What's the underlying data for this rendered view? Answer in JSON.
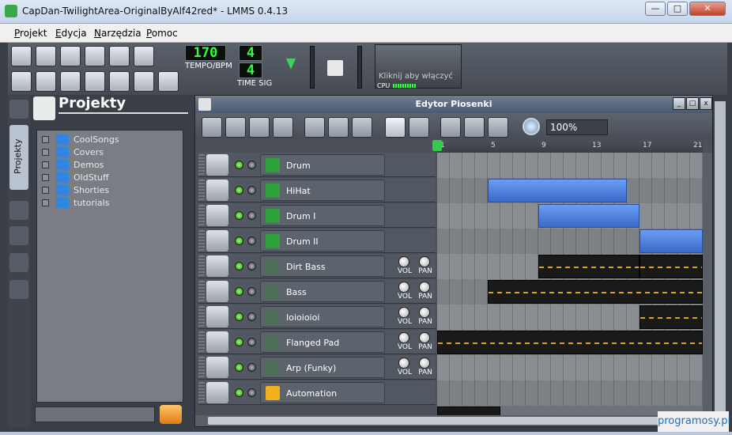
{
  "window": {
    "title": "CapDan-TwilightArea-OriginalByAlf42red* - LMMS 0.4.13",
    "controls": {
      "minimize": "—",
      "maximize": "□",
      "close": "✕"
    }
  },
  "menu": [
    "Projekt",
    "Edycja",
    "Narzędzia",
    "Pomoc"
  ],
  "toolbar": {
    "tempo_value": "170",
    "tempo_label": "TEMPO/BPM",
    "timesig_num": "4",
    "timesig_den": "4",
    "timesig_label": "TIME SIG",
    "visualizer_hint": "Kliknij aby włączyć",
    "cpu_label": "CPU"
  },
  "browser": {
    "title": "Projekty",
    "tab_label": "Projekty",
    "items": [
      "CoolSongs",
      "Covers",
      "Demos",
      "OldStuff",
      "Shorties",
      "tutorials"
    ]
  },
  "song_editor": {
    "title": "Edytor Piosenki",
    "zoom": "100%",
    "bars": [
      "1",
      "5",
      "9",
      "13",
      "17",
      "21"
    ],
    "vol_label": "VOL",
    "pan_label": "PAN",
    "tracks": [
      {
        "name": "Drum",
        "type": "beat"
      },
      {
        "name": "HiHat",
        "type": "beat"
      },
      {
        "name": "Drum I",
        "type": "beat"
      },
      {
        "name": "Drum II",
        "type": "beat"
      },
      {
        "name": "Dirt Bass",
        "type": "instrument"
      },
      {
        "name": "Bass",
        "type": "instrument"
      },
      {
        "name": "Ioioioioi",
        "type": "instrument"
      },
      {
        "name": "Flanged Pad",
        "type": "instrument"
      },
      {
        "name": "Arp (Funky)",
        "type": "instrument"
      },
      {
        "name": "Automation",
        "type": "automation"
      }
    ]
  },
  "watermark": "programosy.pl"
}
